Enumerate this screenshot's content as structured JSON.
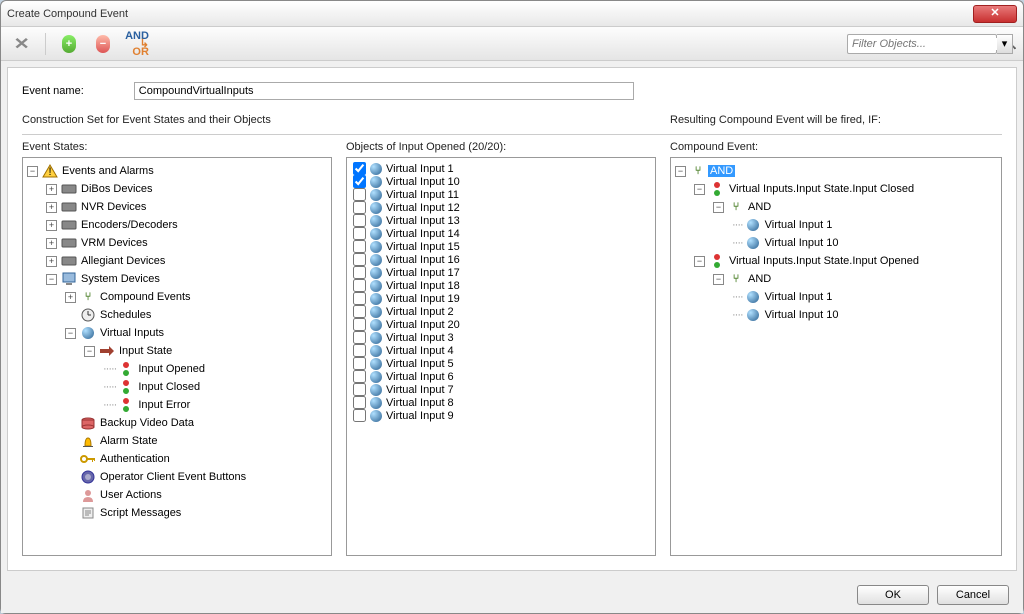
{
  "window": {
    "title": "Create Compound Event",
    "filter_placeholder": "Filter Objects..."
  },
  "labels": {
    "event_name": "Event name:",
    "construction_set": "Construction Set for Event States and their Objects",
    "event_states": "Event States:",
    "objects_of": "Objects of Input Opened (20/20):",
    "resulting": "Resulting Compound Event will be fired, IF:",
    "compound_event": "Compound Event:"
  },
  "form": {
    "event_name_value": "CompoundVirtualInputs"
  },
  "event_states_tree": {
    "root": "Events and Alarms",
    "children": [
      "DiBos Devices",
      "NVR Devices",
      "Encoders/Decoders",
      "VRM Devices",
      "Allegiant Devices"
    ],
    "system_devices": "System Devices",
    "system_children": {
      "compound": "Compound Events",
      "schedules": "Schedules",
      "virtual_inputs": "Virtual Inputs",
      "input_state": "Input State",
      "input_opened": "Input Opened",
      "input_closed": "Input Closed",
      "input_error": "Input Error",
      "backup": "Backup Video Data",
      "alarm_state": "Alarm State",
      "authentication": "Authentication",
      "operator_buttons": "Operator Client Event Buttons",
      "user_actions": "User Actions",
      "script_messages": "Script Messages"
    }
  },
  "objects": [
    {
      "label": "Virtual Input 1",
      "checked": true
    },
    {
      "label": "Virtual Input 10",
      "checked": true
    },
    {
      "label": "Virtual Input 11",
      "checked": false
    },
    {
      "label": "Virtual Input 12",
      "checked": false
    },
    {
      "label": "Virtual Input 13",
      "checked": false
    },
    {
      "label": "Virtual Input 14",
      "checked": false
    },
    {
      "label": "Virtual Input 15",
      "checked": false
    },
    {
      "label": "Virtual Input 16",
      "checked": false
    },
    {
      "label": "Virtual Input 17",
      "checked": false
    },
    {
      "label": "Virtual Input 18",
      "checked": false
    },
    {
      "label": "Virtual Input 19",
      "checked": false
    },
    {
      "label": "Virtual Input 2",
      "checked": false
    },
    {
      "label": "Virtual Input 20",
      "checked": false
    },
    {
      "label": "Virtual Input 3",
      "checked": false
    },
    {
      "label": "Virtual Input 4",
      "checked": false
    },
    {
      "label": "Virtual Input 5",
      "checked": false
    },
    {
      "label": "Virtual Input 6",
      "checked": false
    },
    {
      "label": "Virtual Input 7",
      "checked": false
    },
    {
      "label": "Virtual Input 8",
      "checked": false
    },
    {
      "label": "Virtual Input 9",
      "checked": false
    }
  ],
  "compound_tree": {
    "root": "AND",
    "closed": {
      "label": "Virtual Inputs.Input State.Input Closed",
      "and": "AND",
      "v1": "Virtual Input 1",
      "v10": "Virtual Input 10"
    },
    "opened": {
      "label": "Virtual Inputs.Input State.Input Opened",
      "and": "AND",
      "v1": "Virtual Input 1",
      "v10": "Virtual Input 10"
    }
  },
  "buttons": {
    "ok": "OK",
    "cancel": "Cancel"
  }
}
